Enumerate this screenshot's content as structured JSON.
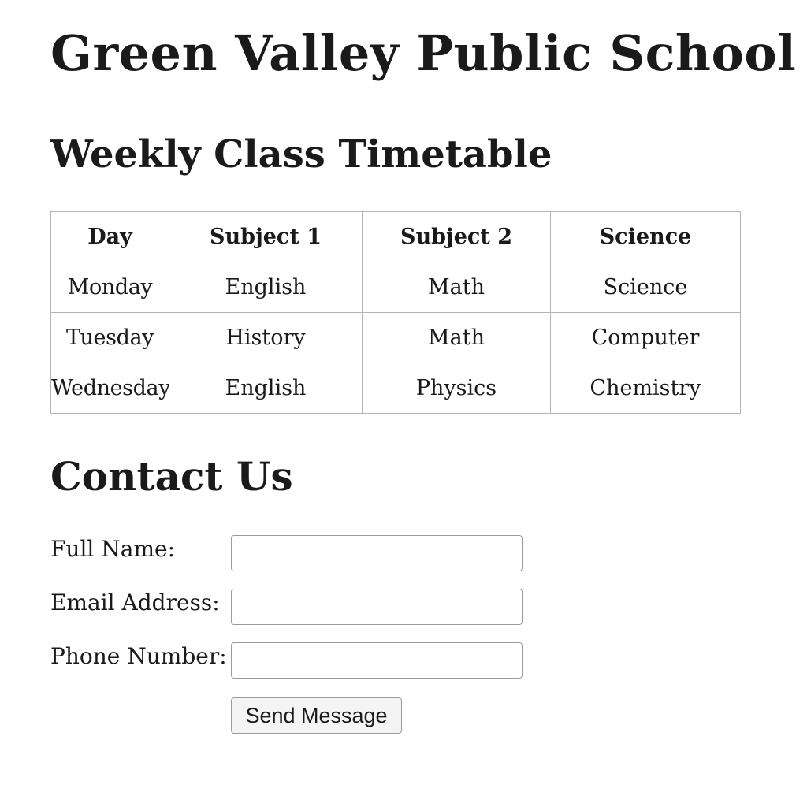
{
  "page": {
    "school_name": "Green Valley Public School"
  },
  "timetable": {
    "heading": "Weekly Class Timetable",
    "headers": [
      "Day",
      "Subject 1",
      "Subject 2",
      "Science"
    ],
    "rows": [
      [
        "Monday",
        "English",
        "Math",
        "Science"
      ],
      [
        "Tuesday",
        "History",
        "Math",
        "Computer"
      ],
      [
        "Wednesday",
        "English",
        "Physics",
        "Chemistry"
      ]
    ]
  },
  "contact": {
    "heading": "Contact Us",
    "full_name_label": "Full Name:",
    "full_name_value": "",
    "email_label": "Email Address:",
    "email_value": "",
    "phone_label": "Phone Number:",
    "phone_value": "",
    "submit_label": "Send Message"
  }
}
